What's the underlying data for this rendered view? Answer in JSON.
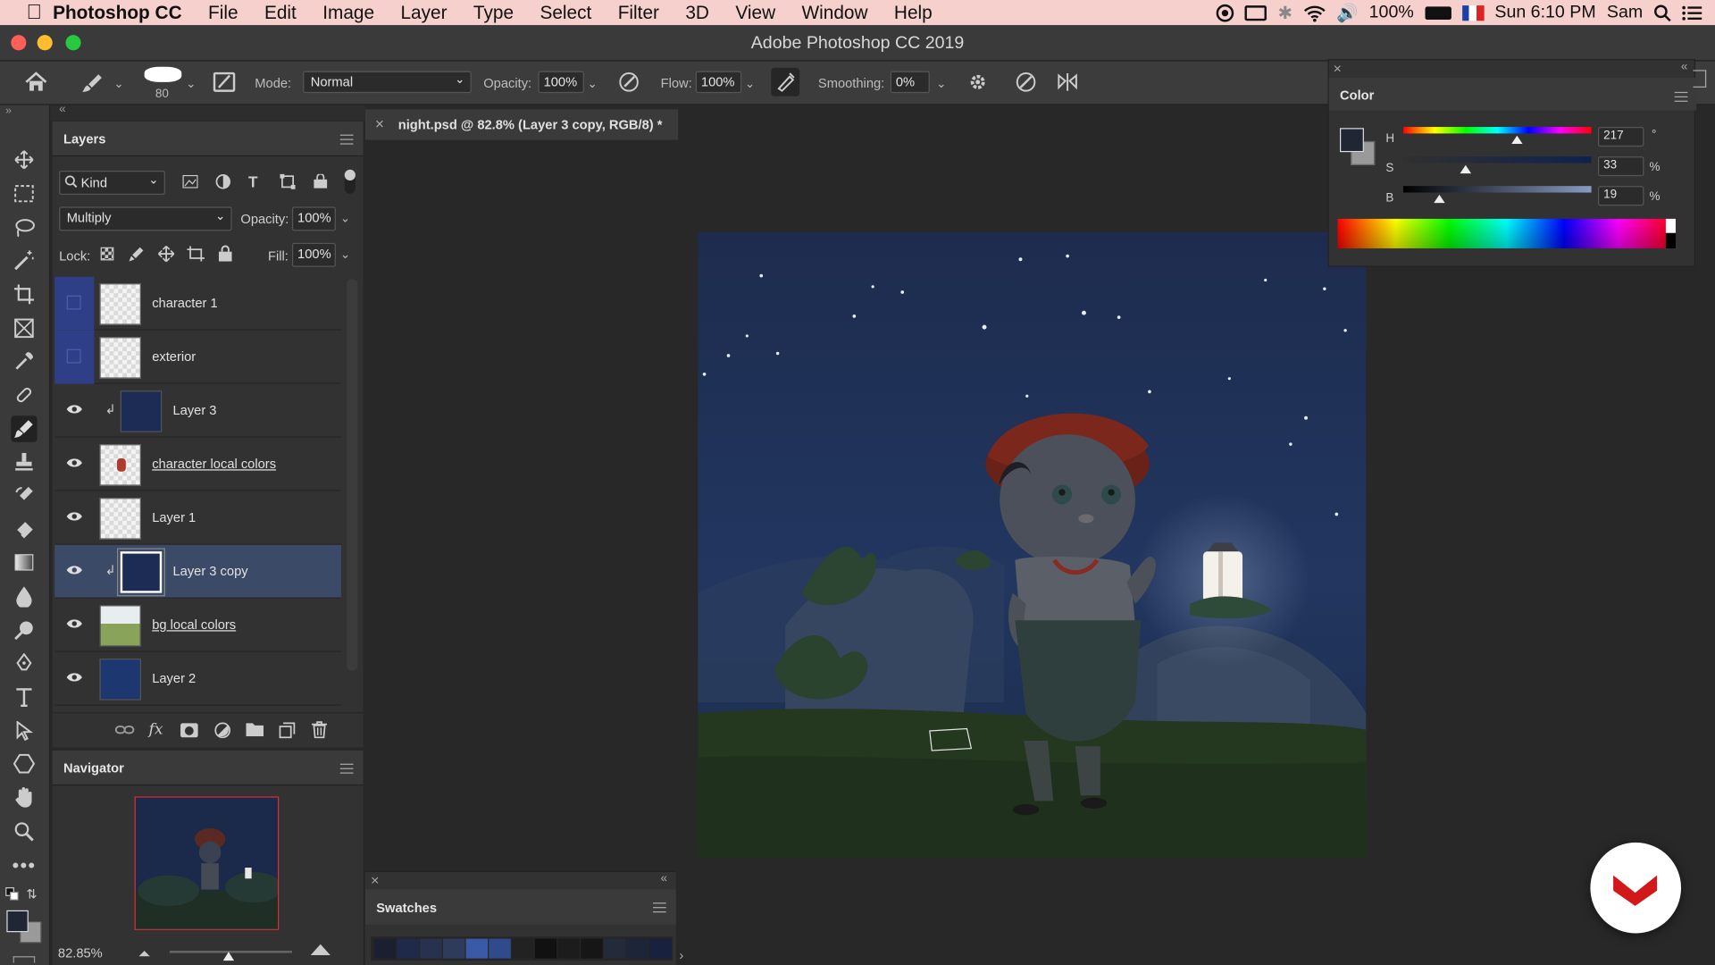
{
  "menubar": {
    "app": "Photoshop CC",
    "items": [
      "File",
      "Edit",
      "Image",
      "Layer",
      "Type",
      "Select",
      "Filter",
      "3D",
      "View",
      "Window",
      "Help"
    ],
    "battery": "100%",
    "clock": "Sun 6:10 PM",
    "user": "Sam"
  },
  "window": {
    "title": "Adobe Photoshop CC 2019"
  },
  "options": {
    "brush_size": "80",
    "mode_label": "Mode:",
    "mode_value": "Normal",
    "opacity_label": "Opacity:",
    "opacity_value": "100%",
    "flow_label": "Flow:",
    "flow_value": "100%",
    "smoothing_label": "Smoothing:",
    "smoothing_value": "0%"
  },
  "doc_tab": {
    "title": "night.psd @ 82.8% (Layer 3 copy, RGB/8) *"
  },
  "layers": {
    "title": "Layers",
    "filter": "Kind",
    "blend_mode": "Multiply",
    "opacity_label": "Opacity:",
    "opacity_value": "100%",
    "lock_label": "Lock:",
    "fill_label": "Fill:",
    "fill_value": "100%",
    "items": [
      {
        "name": "character 1",
        "visible": false,
        "selected": false
      },
      {
        "name": "exterior",
        "visible": false,
        "selected": false
      },
      {
        "name": "Layer 3",
        "visible": true,
        "selected": false,
        "clipped": true
      },
      {
        "name": "character local colors",
        "visible": true,
        "selected": false
      },
      {
        "name": "Layer 1",
        "visible": true,
        "selected": false
      },
      {
        "name": "Layer 3 copy",
        "visible": true,
        "selected": true,
        "clipped": true
      },
      {
        "name": "bg local colors",
        "visible": true,
        "selected": false
      },
      {
        "name": "Layer 2",
        "visible": true,
        "selected": false
      }
    ]
  },
  "navigator": {
    "title": "Navigator",
    "zoom": "82.85%"
  },
  "color": {
    "title": "Color",
    "h_label": "H",
    "h_value": "217",
    "h_unit": "°",
    "s_label": "S",
    "s_value": "33",
    "s_unit": "%",
    "b_label": "B",
    "b_value": "19",
    "b_unit": "%",
    "foreground": "#202634"
  },
  "swatches": {
    "title": "Swatches",
    "colors": [
      "#1b2030",
      "#1f2a4a",
      "#27324f",
      "#2f3b5c",
      "#3a5aa8",
      "#2f4b8c",
      "#222",
      "#111",
      "#1c1c1c",
      "#161616",
      "#232a3a",
      "#1d2538",
      "#18213d"
    ]
  }
}
